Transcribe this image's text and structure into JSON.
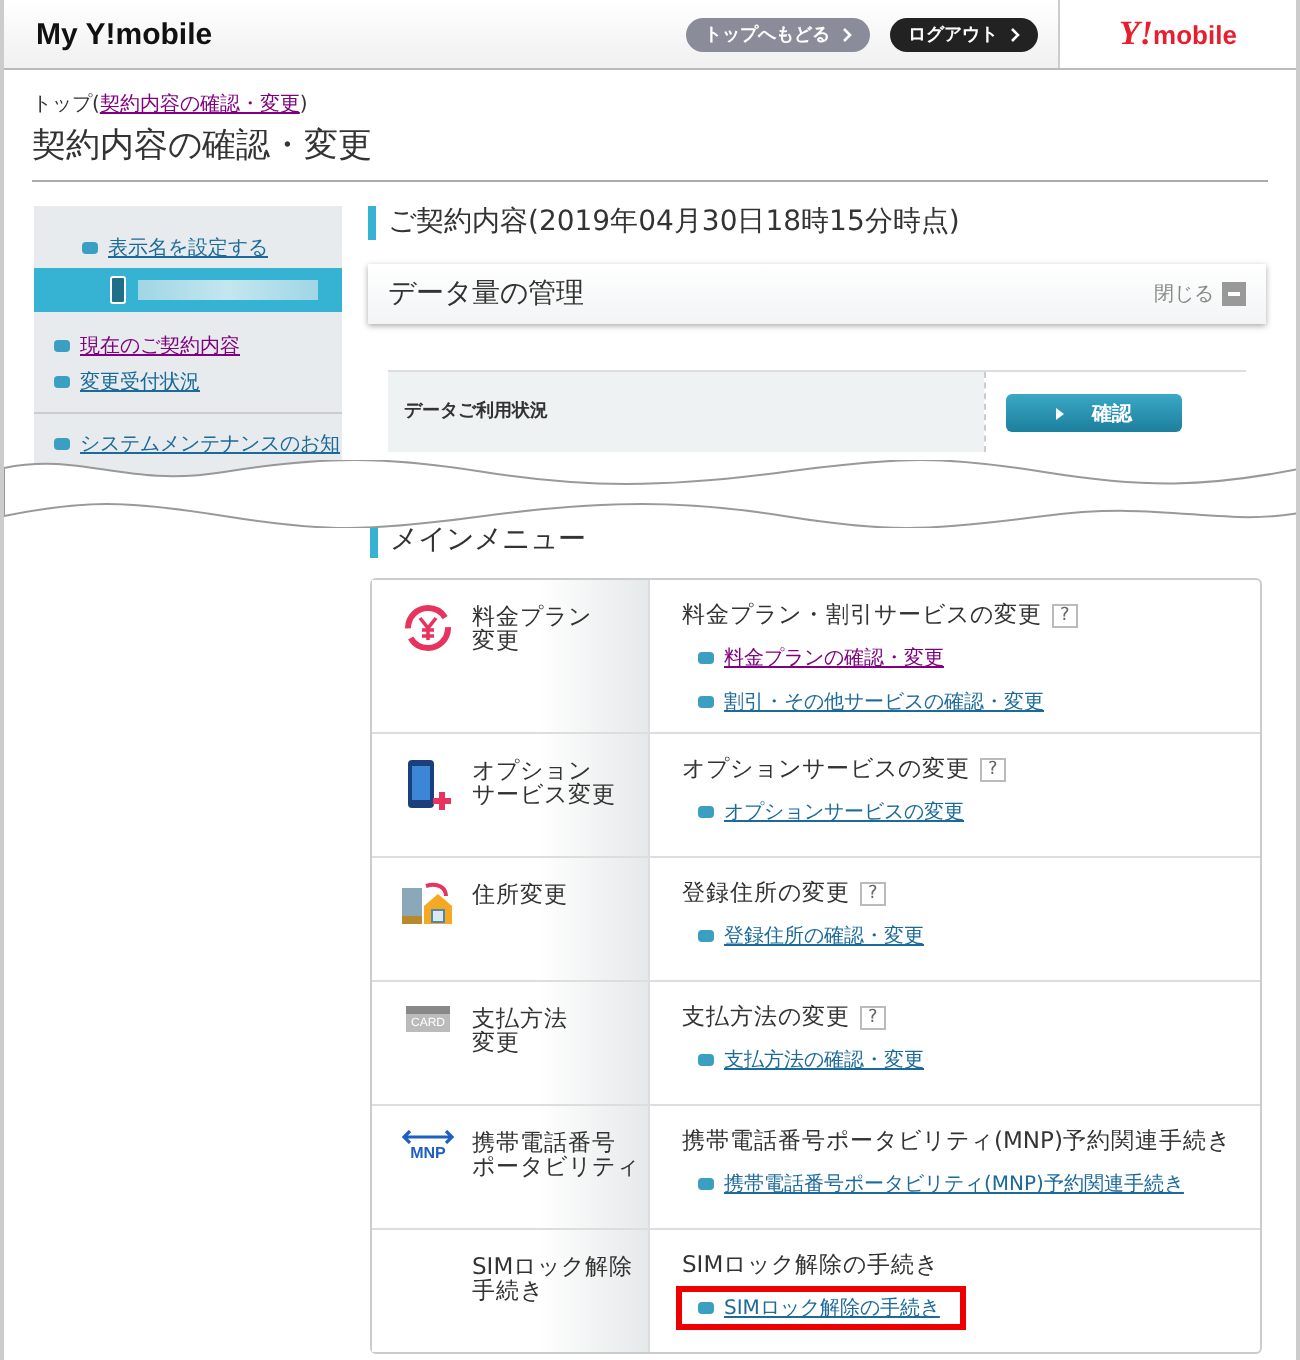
{
  "header": {
    "logo": "My Y!mobile",
    "buttons": [
      {
        "label": "トップへもどる",
        "kind": "secondary"
      },
      {
        "label": "ログアウト",
        "kind": "primary"
      }
    ],
    "brand": {
      "mark": "Y!",
      "name": "mobile"
    }
  },
  "breadcrumb": {
    "prefix": "トップ(",
    "link": "契約内容の確認・変更",
    "suffix": ")"
  },
  "page_title": "契約内容の確認・変更",
  "sidebar": {
    "top_link": "表示名を設定する",
    "links": [
      {
        "label": "現在のご契約内容",
        "visited": true
      },
      {
        "label": "変更受付状況",
        "visited": false
      }
    ],
    "notice": "システムメンテナンスのお知"
  },
  "contract": {
    "heading": "ご契約内容(2019年04月30日18時15分時点)",
    "panel_title": "データ量の管理",
    "close_label": "閉じる",
    "usage_label": "データご利用状況",
    "confirm_button": "確認"
  },
  "main_menu": {
    "heading": "メインメニュー",
    "rows": [
      {
        "kind": "yen",
        "title_lines": [
          "料金プラン",
          "変更"
        ],
        "subtitle": "料金プラン・割引サービスの変更",
        "help": "?",
        "links": [
          {
            "label": "料金プランの確認・変更",
            "visited": true,
            "highlighted": false
          },
          {
            "label": "割引・その他サービスの確認・変更",
            "visited": false,
            "highlighted": false
          }
        ]
      },
      {
        "kind": "phone",
        "title_lines": [
          "オプション",
          "サービス変更"
        ],
        "subtitle": "オプションサービスの変更",
        "help": "?",
        "links": [
          {
            "label": "オプションサービスの変更",
            "visited": false,
            "highlighted": false
          }
        ]
      },
      {
        "kind": "house",
        "title_lines": [
          "住所変更"
        ],
        "subtitle": "登録住所の変更",
        "help": "?",
        "links": [
          {
            "label": "登録住所の確認・変更",
            "visited": false,
            "highlighted": false
          }
        ]
      },
      {
        "kind": "card",
        "icon_text": "CARD",
        "title_lines": [
          "支払方法",
          "変更"
        ],
        "subtitle": "支払方法の変更",
        "help": "?",
        "links": [
          {
            "label": "支払方法の確認・変更",
            "visited": false,
            "highlighted": false
          }
        ]
      },
      {
        "kind": "mnp",
        "icon_text": "MNP",
        "title_lines": [
          "携帯電話番号",
          "ポータビリティ"
        ],
        "subtitle": "携帯電話番号ポータビリティ(MNP)予約関連手続き",
        "links": [
          {
            "label": "携帯電話番号ポータビリティ(MNP)予約関連手続き",
            "visited": false,
            "highlighted": false
          }
        ]
      },
      {
        "kind": "plain",
        "title_lines": [
          "SIMロック解除",
          "手続き"
        ],
        "subtitle": "SIMロック解除の手続き",
        "links": [
          {
            "label": "SIMロック解除の手続き",
            "visited": false,
            "highlighted": true
          }
        ]
      }
    ]
  }
}
